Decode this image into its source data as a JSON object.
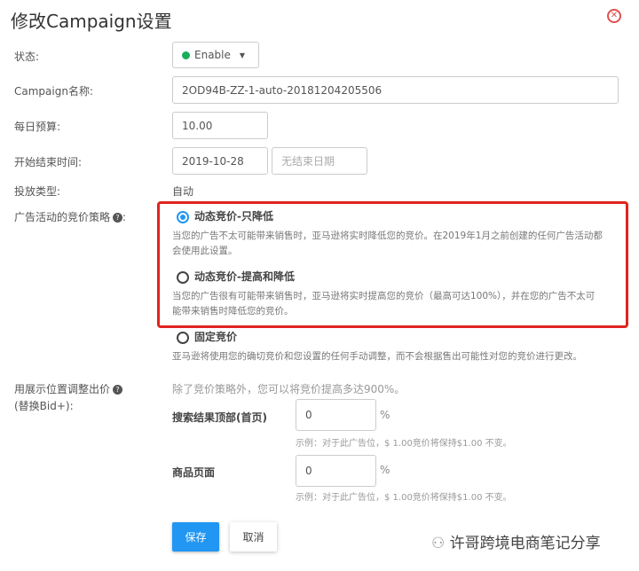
{
  "dialog": {
    "title": "修改Campaign设置"
  },
  "labels": {
    "status": "状态:",
    "name": "Campaign名称:",
    "budget": "每日预算:",
    "dates": "开始结束时间:",
    "type": "投放类型:",
    "strategy": "广告活动的竞价策略",
    "bidplus1": "用展示位置调整出价",
    "bidplus2": "(替换Bid+):"
  },
  "status": {
    "value": "Enable"
  },
  "campaign_name": "2OD94B-ZZ-1-auto-20181204205506",
  "budget": "10.00",
  "start_date": "2019-10-28",
  "end_date_placeholder": "无结束日期",
  "type_value": "自动",
  "strategies": [
    {
      "label": "动态竞价-只降低",
      "desc1": "当您的广告不太可能带来销售时，亚马逊将实时降低您的竞价。在2019年1月之前创建的任何广告活动都",
      "desc2": "会使用此设置。",
      "selected": true
    },
    {
      "label": "动态竞价-提高和降低",
      "desc1": "当您的广告很有可能带来销售时，亚马逊将实时提高您的竞价（最高可达100%），并在您的广告不太可",
      "desc2": "能带来销售时降低您的竞价。",
      "selected": false
    },
    {
      "label": "固定竞价",
      "desc1": "亚马逊将使用您的确切竞价和您设置的任何手动调整，而不会根据售出可能性对您的竞价进行更改。",
      "selected": false
    }
  ],
  "bidplus": {
    "intro": "除了竞价策略外，您可以将竞价提高多达900%。",
    "rows": [
      {
        "label": "搜索结果顶部(首页)",
        "value": "0",
        "unit": "%",
        "example": "示例：对于此广告位，$ 1.00竞价将保持$1.00 不变。"
      },
      {
        "label": "商品页面",
        "value": "0",
        "unit": "%",
        "example": "示例：对于此广告位，$ 1.00竞价将保持$1.00 不变。"
      }
    ]
  },
  "buttons": {
    "save": "保存",
    "cancel": "取消"
  },
  "watermark": "许哥跨境电商笔记分享",
  "colors": {
    "primary": "#2196f3",
    "highlight": "#e0241f",
    "enabled": "#1aad5a"
  }
}
